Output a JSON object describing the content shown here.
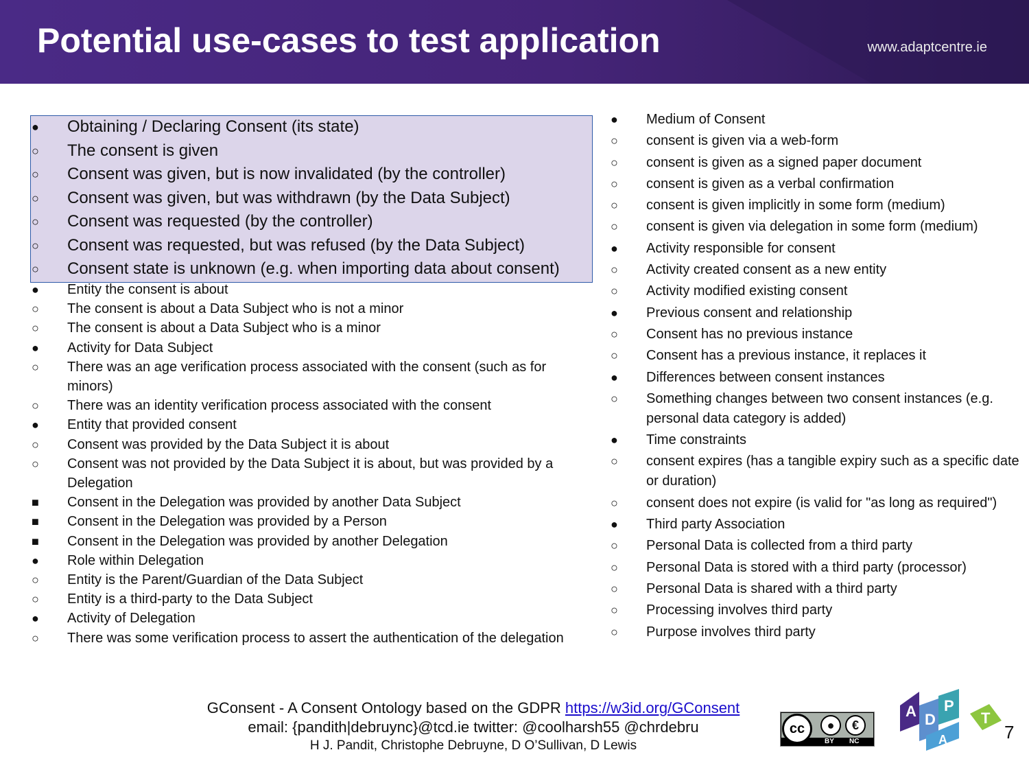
{
  "header": {
    "title": "Potential use-cases to test application",
    "site": "www.adaptcentre.ie"
  },
  "left_big": [
    {
      "bullet": "●",
      "text": "Obtaining / Declaring Consent (its state)"
    },
    {
      "bullet": "○",
      "text": "The consent is given"
    },
    {
      "bullet": "○",
      "text": "Consent was given, but is now invalidated (by the controller)"
    },
    {
      "bullet": "○",
      "text": "Consent was given, but was withdrawn (by the Data Subject)"
    },
    {
      "bullet": "○",
      "text": "Consent was requested (by the controller)"
    },
    {
      "bullet": "○",
      "text": "Consent was requested, but was refused (by the Data Subject)"
    },
    {
      "bullet": "○",
      "text": "Consent state is unknown (e.g. when importing data about consent)"
    }
  ],
  "left_small": [
    {
      "bullet": "●",
      "text": "Entity the consent is about"
    },
    {
      "bullet": "○",
      "text": "The consent is about a Data Subject who is not a minor"
    },
    {
      "bullet": "○",
      "text": "The consent is about a Data Subject who is a minor"
    },
    {
      "bullet": "●",
      "text": "Activity for Data Subject"
    },
    {
      "bullet": "○",
      "text": "There was an age verification process associated with the consent (such as for minors)"
    },
    {
      "bullet": "○",
      "text": "There was an identity verification process associated with the consent"
    },
    {
      "bullet": "●",
      "text": "Entity that provided consent"
    },
    {
      "bullet": "○",
      "text": "Consent was provided by the Data Subject it is about"
    },
    {
      "bullet": "○",
      "text": "Consent was not provided by the Data Subject it is about, but was provided by a Delegation"
    },
    {
      "bullet": "■",
      "text": "Consent in the Delegation was provided by another Data Subject"
    },
    {
      "bullet": "■",
      "text": "Consent in the Delegation was provided by a Person"
    },
    {
      "bullet": "■",
      "text": "Consent in the Delegation was provided by another Delegation"
    },
    {
      "bullet": "●",
      "text": "Role within Delegation"
    },
    {
      "bullet": "○",
      "text": "Entity is the Parent/Guardian of the Data Subject"
    },
    {
      "bullet": "○",
      "text": "Entity is a third-party to the Data Subject"
    },
    {
      "bullet": "●",
      "text": "Activity of Delegation"
    },
    {
      "bullet": "○",
      "text": "There was some verification process to assert the authentication of the delegation"
    }
  ],
  "right": [
    {
      "bullet": "●",
      "text": "Medium of Consent"
    },
    {
      "bullet": "○",
      "text": "consent is given via a web-form"
    },
    {
      "bullet": "○",
      "text": "consent is given as a signed paper document"
    },
    {
      "bullet": "○",
      "text": "consent is given as a verbal confirmation"
    },
    {
      "bullet": "○",
      "text": "consent is given implicitly in some form (medium)"
    },
    {
      "bullet": "○",
      "text": "consent is given via delegation in some form (medium)"
    },
    {
      "bullet": "●",
      "text": "Activity responsible for consent"
    },
    {
      "bullet": "○",
      "text": "Activity created consent as a new entity"
    },
    {
      "bullet": "○",
      "text": "Activity modified existing consent"
    },
    {
      "bullet": "●",
      "text": "Previous consent and relationship"
    },
    {
      "bullet": "○",
      "text": "Consent has no previous instance"
    },
    {
      "bullet": "○",
      "text": "Consent has a previous instance, it replaces it"
    },
    {
      "bullet": "●",
      "text": "Differences between consent instances"
    },
    {
      "bullet": "○",
      "text": "Something changes between two consent instances (e.g. personal data category is added)"
    },
    {
      "bullet": "●",
      "text": "Time constraints"
    },
    {
      "bullet": "○",
      "text": "consent expires (has a tangible expiry such as a specific date or duration)"
    },
    {
      "bullet": "○",
      "text": "consent does not expire (is valid for \"as long as required\")"
    },
    {
      "bullet": "●",
      "text": "Third party Association"
    },
    {
      "bullet": "○",
      "text": "Personal Data is collected from a third party"
    },
    {
      "bullet": "○",
      "text": "Personal Data is stored with a third party (processor)"
    },
    {
      "bullet": "○",
      "text": "Personal Data is shared with a third party"
    },
    {
      "bullet": "○",
      "text": "Processing involves third party"
    },
    {
      "bullet": "○",
      "text": "Purpose involves third party"
    }
  ],
  "footer": {
    "line1_text": "GConsent - A Consent Ontology based on the GDPR ",
    "line1_link": "https://w3id.org/GConsent",
    "line2": "email: {pandith|debruync}@tcd.ie twitter: @coolharsh55 @chrdebru",
    "line3": "H J. Pandit, Christophe Debruyne, D O’Sullivan, D Lewis"
  },
  "license": {
    "cc": "cc",
    "by": "BY",
    "nc": "NC"
  },
  "logo_letters": [
    "A",
    "D",
    "P",
    "A",
    "T"
  ],
  "page_number": "7"
}
